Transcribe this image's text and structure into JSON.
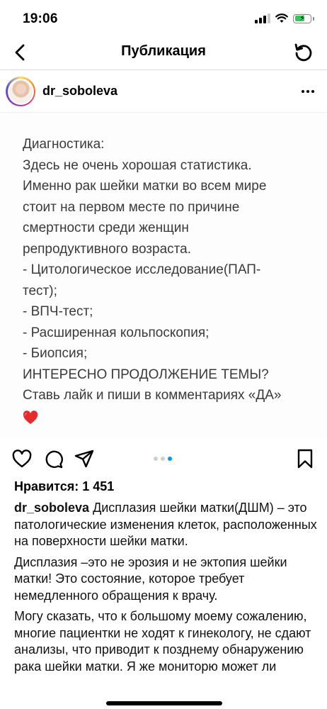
{
  "status_bar": {
    "time": "19:06",
    "icons": [
      "cellular-signal-icon",
      "wifi-icon",
      "battery-charging-icon"
    ]
  },
  "nav": {
    "title": "Публикация",
    "back_icon": "chevron-left-icon",
    "refresh_icon": "refresh-icon"
  },
  "post": {
    "username": "dr_soboleva",
    "more_icon": "more-dots-icon",
    "image_text": {
      "lines": [
        "Диагностика:",
        "Здесь не очень хорошая статистика.",
        "Именно рак шейки матки во всем мире",
        "стоит на первом месте по причине",
        "смертности среди женщин",
        "репродуктивного возраста.",
        "- Цитологическое исследование(ПАП-",
        "тест);",
        "- ВПЧ-тест;",
        "- Расширенная кольпоскопия;",
        "- Биопсия;",
        "ИНТЕРЕСНО ПРОДОЛЖЕНИЕ ТЕМЫ?",
        "Ставь лайк и пиши в комментариях «ДА»"
      ],
      "emoji": "red-heart-emoji"
    },
    "carousel": {
      "count": 3,
      "active": 3
    },
    "actions": [
      "heart-icon",
      "comment-icon",
      "share-icon",
      "bookmark-icon"
    ],
    "likes": "Нравится: 1 451",
    "caption": {
      "username": "dr_soboleva",
      "p1": "Дисплазия шейки матки(ДШМ) – это патологические изменения клеток, расположенных на поверхности шейки матки.",
      "p2": "Дисплазия –это не эрозия и не эктопия шейки матки! Это состояние, которое требует немедленного обращения к врачу.",
      "p3": "Могу сказать, что к большому моему сожалению, многие пациентки  не ходят к гинекологу, не сдают анализы, что приводит к позднему обнаружению рака шейки матки. Я же мониторю может ли"
    }
  }
}
